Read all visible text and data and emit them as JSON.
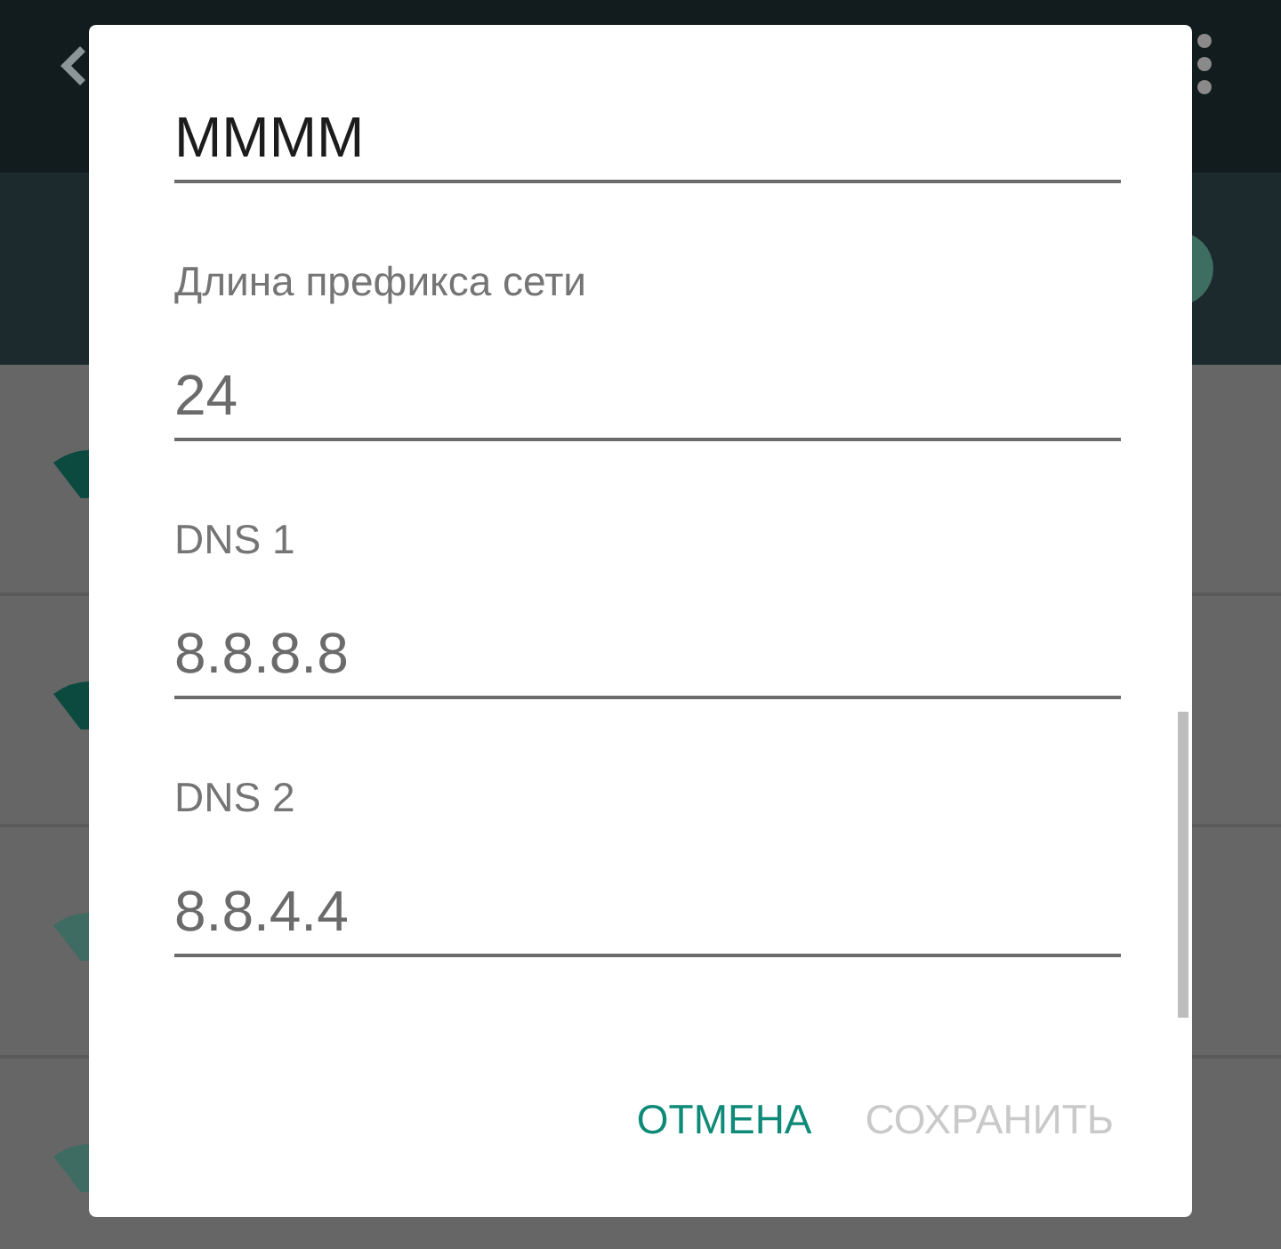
{
  "dialog": {
    "fields": [
      {
        "value": "MMMM",
        "focused": true
      },
      {
        "label": "Длина префикса сети",
        "value": "24",
        "focused": false
      },
      {
        "label": "DNS 1",
        "value": "8.8.8.8",
        "focused": false
      },
      {
        "label": "DNS 2",
        "value": "8.8.4.4",
        "focused": false
      }
    ],
    "buttons": [
      {
        "label": "ОТМЕНА",
        "disabled": false
      },
      {
        "label": "СОХРАНИТЬ",
        "disabled": true
      }
    ]
  }
}
